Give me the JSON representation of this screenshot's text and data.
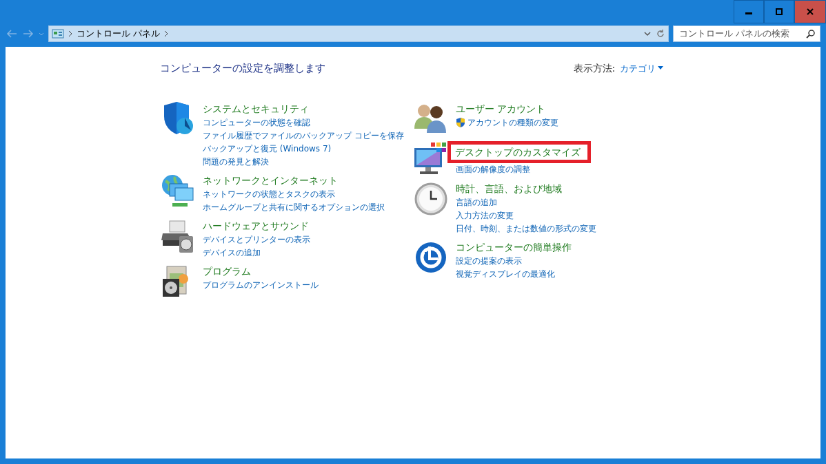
{
  "address_bar": {
    "breadcrumb": "コントロール パネル",
    "search": {
      "placeholder": "コントロール パネルの検索"
    }
  },
  "header": {
    "title": "コンピューターの設定を調整します",
    "view_by_label": "表示方法:",
    "view_by_value": "カテゴリ"
  },
  "left_categories": [
    {
      "title": "システムとセキュリティ",
      "highlighted": false,
      "links": [
        {
          "text": "コンピューターの状態を確認"
        },
        {
          "text": "ファイル履歴でファイルのバックアップ コピーを保存"
        },
        {
          "text": "バックアップと復元 (Windows 7)"
        },
        {
          "text": "問題の発見と解決"
        }
      ]
    },
    {
      "title": "ネットワークとインターネット",
      "highlighted": false,
      "links": [
        {
          "text": "ネットワークの状態とタスクの表示"
        },
        {
          "text": "ホームグループと共有に関するオプションの選択"
        }
      ]
    },
    {
      "title": "ハードウェアとサウンド",
      "highlighted": false,
      "links": [
        {
          "text": "デバイスとプリンターの表示"
        },
        {
          "text": "デバイスの追加"
        }
      ]
    },
    {
      "title": "プログラム",
      "highlighted": false,
      "links": [
        {
          "text": "プログラムのアンインストール"
        }
      ]
    }
  ],
  "right_categories": [
    {
      "title": "ユーザー アカウント",
      "highlighted": false,
      "links": [
        {
          "text": "アカウントの種類の変更",
          "shield": true
        }
      ]
    },
    {
      "title": "デスクトップのカスタマイズ",
      "highlighted": true,
      "links": [
        {
          "text": "画面の解像度の調整"
        }
      ]
    },
    {
      "title": "時計、言語、および地域",
      "highlighted": false,
      "links": [
        {
          "text": "言語の追加"
        },
        {
          "text": "入力方法の変更"
        },
        {
          "text": "日付、時刻、または数値の形式の変更"
        }
      ]
    },
    {
      "title": "コンピューターの簡単操作",
      "highlighted": false,
      "links": [
        {
          "text": "設定の提案の表示"
        },
        {
          "text": "視覚ディスプレイの最適化"
        }
      ]
    }
  ]
}
